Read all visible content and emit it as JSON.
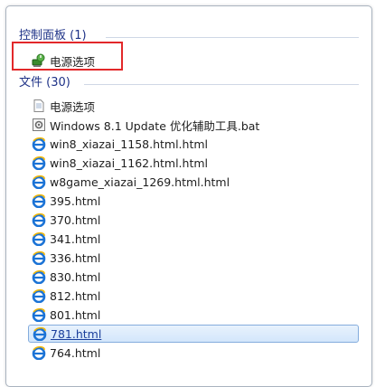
{
  "groups": {
    "control_panel": {
      "header": "控制面板 (1)",
      "items": [
        {
          "label": "电源选项",
          "icon": "power-options-icon"
        }
      ]
    },
    "files": {
      "header": "文件 (30)",
      "items": [
        {
          "label": "电源选项",
          "icon": "document-icon"
        },
        {
          "label": "Windows 8.1 Update 优化辅助工具.bat",
          "icon": "batch-file-icon"
        },
        {
          "label": "win8_xiazai_1158.html.html",
          "icon": "ie-icon"
        },
        {
          "label": "win8_xiazai_1162.html.html",
          "icon": "ie-icon"
        },
        {
          "label": "w8game_xiazai_1269.html.html",
          "icon": "ie-icon"
        },
        {
          "label": "395.html",
          "icon": "ie-icon"
        },
        {
          "label": "370.html",
          "icon": "ie-icon"
        },
        {
          "label": "341.html",
          "icon": "ie-icon"
        },
        {
          "label": "336.html",
          "icon": "ie-icon"
        },
        {
          "label": "830.html",
          "icon": "ie-icon"
        },
        {
          "label": "812.html",
          "icon": "ie-icon"
        },
        {
          "label": "801.html",
          "icon": "ie-icon"
        },
        {
          "label": "781.html",
          "icon": "ie-icon",
          "selected": true
        },
        {
          "label": "764.html",
          "icon": "ie-icon"
        }
      ]
    }
  },
  "colors": {
    "header_text": "#1e3287",
    "highlight_border": "#e2282a",
    "selection_border": "#84acdd"
  }
}
